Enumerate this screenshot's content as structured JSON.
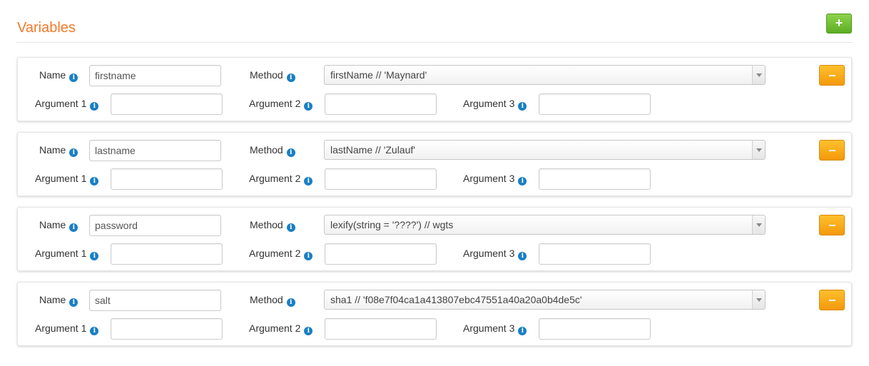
{
  "section": {
    "title": "Variables",
    "add_label": "+"
  },
  "labels": {
    "name": "Name",
    "method": "Method",
    "argument1": "Argument 1",
    "argument2": "Argument 2",
    "argument3": "Argument 3",
    "info_glyph": "i"
  },
  "variables": [
    {
      "name": "firstname",
      "method": "firstName // 'Maynard'",
      "argument1": "",
      "argument2": "",
      "argument3": ""
    },
    {
      "name": "lastname",
      "method": "lastName // 'Zulauf'",
      "argument1": "",
      "argument2": "",
      "argument3": ""
    },
    {
      "name": "password",
      "method": "lexify(string = '????') // wgts",
      "argument1": "",
      "argument2": "",
      "argument3": ""
    },
    {
      "name": "salt",
      "method": "sha1 // 'f08e7f04ca1a413807ebc47551a40a20a0b4de5c'",
      "argument1": "",
      "argument2": "",
      "argument3": ""
    }
  ],
  "colors": {
    "title": "#f07a2b",
    "add_button": "#5cae23",
    "remove_button": "#f4990a",
    "info_icon": "#1a7fc4"
  },
  "icons": {
    "add": "plus-icon",
    "remove": "minus-icon",
    "info": "info-icon",
    "dropdown": "chevron-down-icon"
  }
}
